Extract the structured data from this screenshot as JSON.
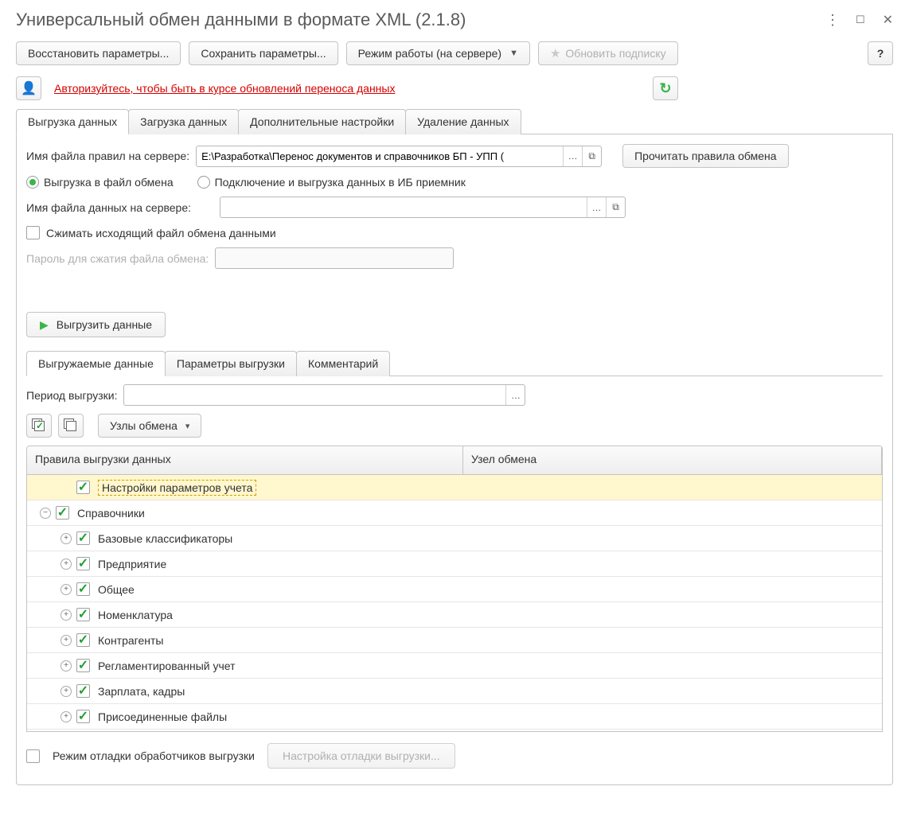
{
  "window": {
    "title": "Универсальный обмен данными в формате XML (2.1.8)"
  },
  "toolbar": {
    "restore": "Восстановить параметры...",
    "save": "Сохранить параметры...",
    "mode": "Режим работы (на сервере)",
    "subscribe": "Обновить подписку",
    "help": "?"
  },
  "auth": {
    "link": "Авторизуйтесь, чтобы быть в курсе обновлений переноса данных"
  },
  "tabs": [
    {
      "id": "export",
      "label": "Выгрузка данных",
      "active": true
    },
    {
      "id": "import",
      "label": "Загрузка данных",
      "active": false
    },
    {
      "id": "settings",
      "label": "Дополнительные настройки",
      "active": false
    },
    {
      "id": "delete",
      "label": "Удаление данных",
      "active": false
    }
  ],
  "export": {
    "rules_label": "Имя файла правил на сервере:",
    "rules_value": "E:\\Разработка\\Перенос документов и справочников БП - УПП (",
    "read_rules_btn": "Прочитать правила обмена",
    "radio_file": "Выгрузка в файл обмена",
    "radio_ib": "Подключение и выгрузка данных в ИБ приемник",
    "data_file_label": "Имя файла данных на сервере:",
    "data_file_value": "",
    "compress": "Сжимать исходящий файл обмена данными",
    "compress_pwd": "Пароль для сжатия файла обмена:",
    "export_btn": "Выгрузить данные",
    "subtabs": [
      {
        "id": "data",
        "label": "Выгружаемые данные",
        "active": true
      },
      {
        "id": "params",
        "label": "Параметры выгрузки",
        "active": false
      },
      {
        "id": "comment",
        "label": "Комментарий",
        "active": false
      }
    ],
    "period_label": "Период выгрузки:",
    "period_value": "",
    "nodes_btn": "Узлы обмена",
    "columns": {
      "col1": "Правила выгрузки данных",
      "col2": "Узел обмена"
    },
    "rows": [
      {
        "indent": 1,
        "toggle": null,
        "checked": true,
        "label": "Настройки параметров учета",
        "selected": true
      },
      {
        "indent": 0,
        "toggle": "minus",
        "checked": true,
        "label": "Справочники"
      },
      {
        "indent": 1,
        "toggle": "plus",
        "checked": true,
        "label": "Базовые классификаторы"
      },
      {
        "indent": 1,
        "toggle": "plus",
        "checked": true,
        "label": "Предприятие"
      },
      {
        "indent": 1,
        "toggle": "plus",
        "checked": true,
        "label": "Общее"
      },
      {
        "indent": 1,
        "toggle": "plus",
        "checked": true,
        "label": "Номенклатура"
      },
      {
        "indent": 1,
        "toggle": "plus",
        "checked": true,
        "label": "Контрагенты"
      },
      {
        "indent": 1,
        "toggle": "plus",
        "checked": true,
        "label": "Регламентированный учет"
      },
      {
        "indent": 1,
        "toggle": "plus",
        "checked": true,
        "label": "Зарплата, кадры"
      },
      {
        "indent": 1,
        "toggle": "plus",
        "checked": true,
        "label": "Присоединенные файлы"
      }
    ],
    "debug_chk": "Режим отладки обработчиков выгрузки",
    "debug_btn": "Настройка отладки выгрузки..."
  }
}
